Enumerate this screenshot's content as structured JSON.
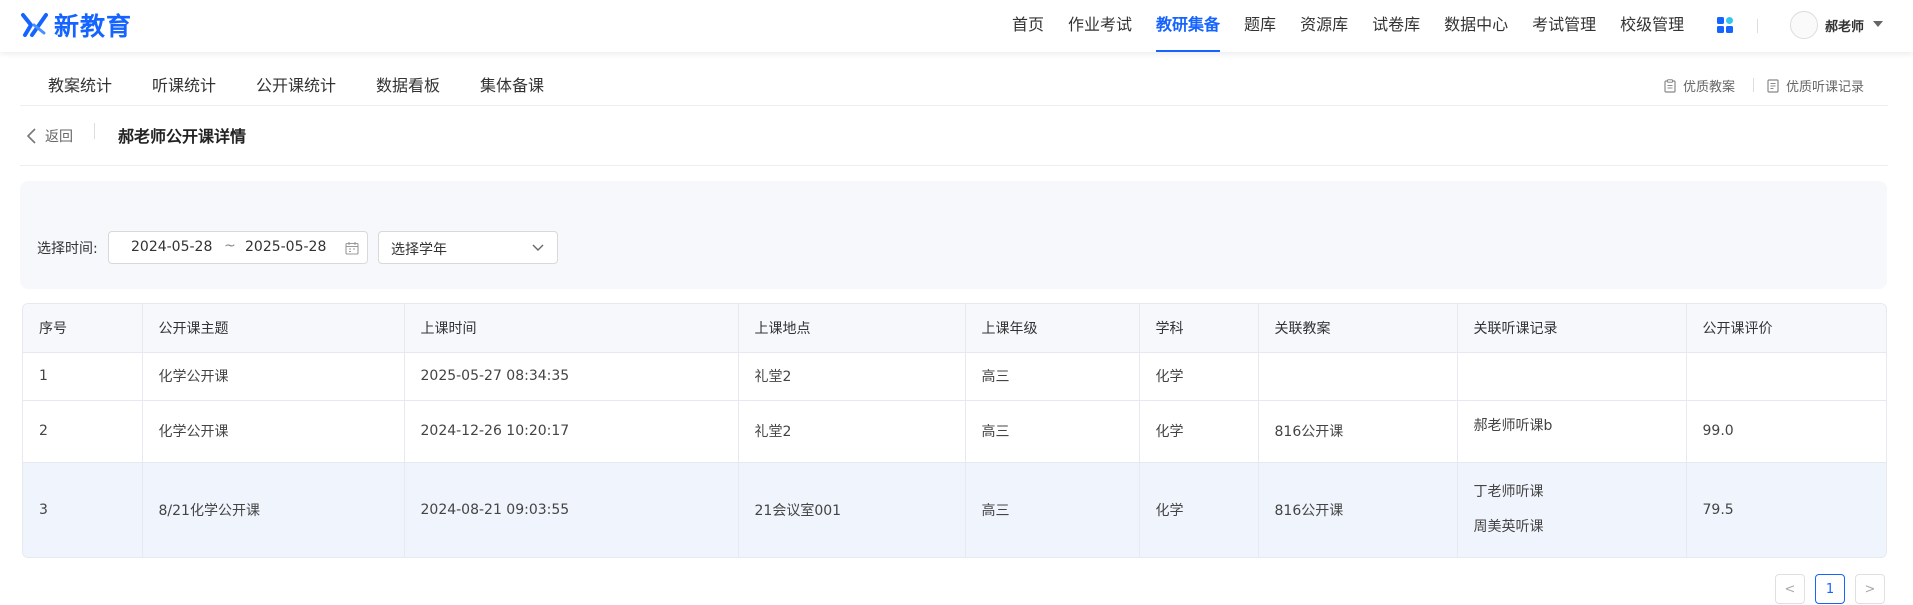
{
  "brand": {
    "name": "新教育",
    "accent": "#1664ff"
  },
  "nav": {
    "items": [
      "首页",
      "作业考试",
      "教研集备",
      "题库",
      "资源库",
      "试卷库",
      "数据中心",
      "考试管理",
      "校级管理"
    ],
    "active_index": 2
  },
  "user": {
    "name": "郝老师"
  },
  "subnav": {
    "items": [
      "教案统计",
      "听课统计",
      "公开课统计",
      "数据看板",
      "集体备课"
    ],
    "right_links": [
      "优质教案",
      "优质听课记录"
    ]
  },
  "header": {
    "back_label": "返回",
    "title": "郝老师公开课详情"
  },
  "filter": {
    "time_label": "选择时间:",
    "date_start": "2024-05-28",
    "date_separator": "~",
    "date_end": "2025-05-28",
    "year_select_placeholder": "选择学年"
  },
  "table": {
    "columns": [
      "序号",
      "公开课主题",
      "上课时间",
      "上课地点",
      "上课年级",
      "学科",
      "关联教案",
      "关联听课记录",
      "公开课评价"
    ],
    "rows": [
      {
        "index": "1",
        "topic": "化学公开课",
        "time": "2025-05-27 08:34:35",
        "location": "礼堂2",
        "grade": "高三",
        "subject": "化学",
        "lesson_plan": "",
        "records": [],
        "rating": ""
      },
      {
        "index": "2",
        "topic": "化学公开课",
        "time": "2024-12-26 10:20:17",
        "location": "礼堂2",
        "grade": "高三",
        "subject": "化学",
        "lesson_plan": "816公开课",
        "records": [
          "郝老师听课b"
        ],
        "rating": "99.0"
      },
      {
        "index": "3",
        "topic": "8/21化学公开课",
        "time": "2024-08-21 09:03:55",
        "location": "21会议室001",
        "grade": "高三",
        "subject": "化学",
        "lesson_plan": "816公开课",
        "records": [
          "丁老师听课",
          "周美英听课"
        ],
        "rating": "79.5"
      }
    ]
  },
  "pagination": {
    "prev": "<",
    "current": "1",
    "next": ">"
  }
}
